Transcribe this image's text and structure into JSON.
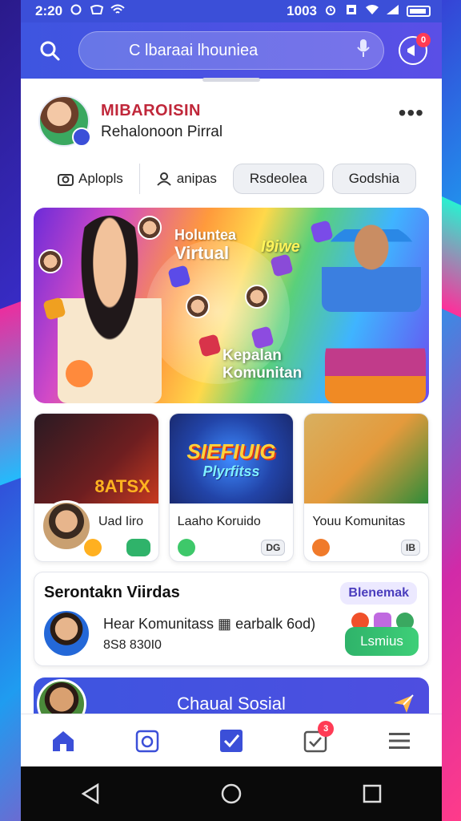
{
  "status_bar": {
    "time": "2:20",
    "battery_text": "1003"
  },
  "search": {
    "placeholder": "C lbaraai lhouniea",
    "notification_count": "0"
  },
  "profile": {
    "name": "MIBAROISIN",
    "subtitle": "Rehalonoon Pirral"
  },
  "chips": [
    {
      "label": "Aplopls",
      "icon": "camera-icon"
    },
    {
      "label": "anipas",
      "icon": "person-icon"
    },
    {
      "label": "Rsdeolea"
    },
    {
      "label": "Godshia"
    }
  ],
  "hero": {
    "title_line1": "Holuntea",
    "title_line2": "Virtual",
    "tag": "I9iwe",
    "caption_line1": "Kepalan",
    "caption_line2": "Komunitan"
  },
  "cards": [
    {
      "title": "Uad Iiro",
      "image_text": "8ATSX",
      "pill": ""
    },
    {
      "title": "Laaho Koruido",
      "image_text_1": "SIEFIUIG",
      "image_text_2": "Plyrfitss",
      "pill": "DG"
    },
    {
      "title": "Youu Komunitas",
      "pill": "IB"
    }
  ],
  "feed": {
    "title": "Serontakn Viirdas",
    "tag": "Blenemak",
    "text": "Hear Komunitass  ▦ earbalk 6od)",
    "meta": "8S8 830I0",
    "button": "Lsmius"
  },
  "chat_button": {
    "label": "Chaual Sosial"
  },
  "bottom_nav": {
    "messages_badge": "3"
  },
  "colors": {
    "primary": "#3b4fd8",
    "profile_name": "#c0273a",
    "accent_green": "#2fb36a",
    "badge_red": "#ff3b55"
  }
}
